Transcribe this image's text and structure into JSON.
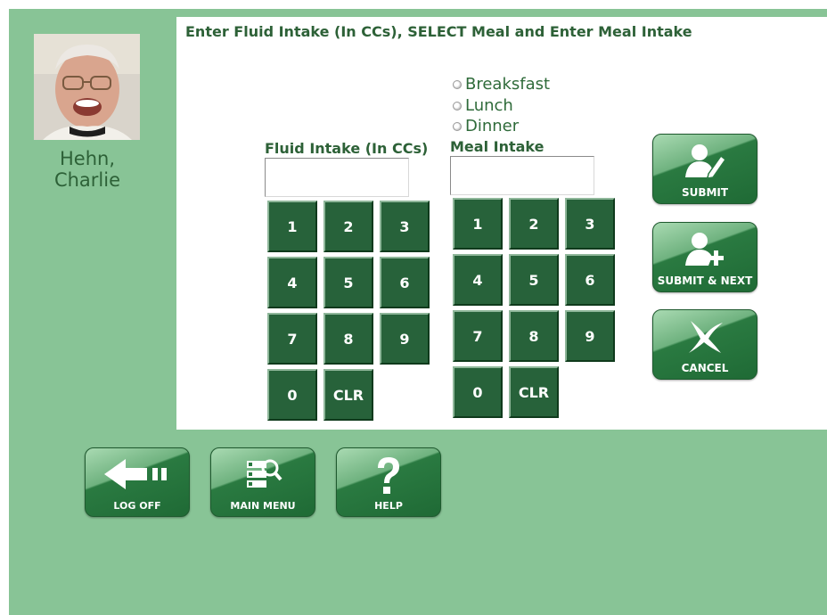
{
  "header": {
    "instruction": "Enter Fluid Intake (In CCs), SELECT Meal and Enter Meal Intake"
  },
  "resident": {
    "name": "Hehn, Charlie"
  },
  "meal_options": [
    "Breaksfast",
    "Lunch",
    "Dinner"
  ],
  "fluid": {
    "label": "Fluid Intake (In CCs)",
    "value": ""
  },
  "meal": {
    "label": "Meal Intake",
    "value": ""
  },
  "keypad": {
    "keys": [
      "1",
      "2",
      "3",
      "4",
      "5",
      "6",
      "7",
      "8",
      "9",
      "0",
      "CLR"
    ]
  },
  "actions": {
    "submit": "SUBMIT",
    "submit_next": "SUBMIT & NEXT",
    "cancel": "CANCEL"
  },
  "nav": {
    "logoff": "LOG OFF",
    "main_menu": "MAIN MENU",
    "help": "HELP"
  },
  "colors": {
    "background": "#88c496",
    "key": "#27623a",
    "text": "#2d6137"
  },
  "icons": {
    "submit": "user-edit-icon",
    "submit_next": "user-add-icon",
    "cancel": "x-icon",
    "logoff": "exit-arrow-icon",
    "main_menu": "menu-search-icon",
    "help": "question-icon"
  }
}
